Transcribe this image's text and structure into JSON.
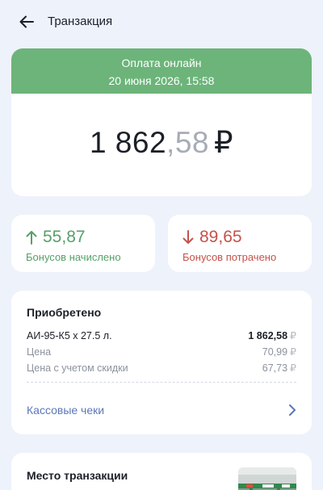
{
  "header": {
    "title": "Транзакция"
  },
  "transaction": {
    "type": "Оплата онлайн",
    "datetime": "20 июня 2026, 15:58",
    "amount_int": "1 862",
    "amount_dec": ",58",
    "currency": "₽"
  },
  "bonuses": {
    "earned_value": "55,87",
    "earned_label": "Бонусов начислено",
    "spent_value": "89,65",
    "spent_label": "Бонусов потрачено"
  },
  "purchase": {
    "title": "Приобретено",
    "item_name": "АИ-95-К5 x 27.5 л.",
    "item_total": "1 862,58",
    "price_label": "Цена",
    "price_value": "70,99",
    "discount_price_label": "Цена с учетом скидки",
    "discount_price_value": "67,73",
    "currency": "₽",
    "receipts_label": "Кассовые чеки"
  },
  "place": {
    "title": "Место транзакции"
  },
  "colors": {
    "accent_green": "#6cb47a",
    "bonus_green": "#56a069",
    "bonus_red": "#c5524a",
    "link_blue": "#5b78b8",
    "background": "#eef2fb"
  },
  "icons": {
    "back": "arrow-left-icon",
    "earned": "arrow-up-icon",
    "spent": "arrow-down-icon",
    "receipts": "chevron-right-icon"
  }
}
